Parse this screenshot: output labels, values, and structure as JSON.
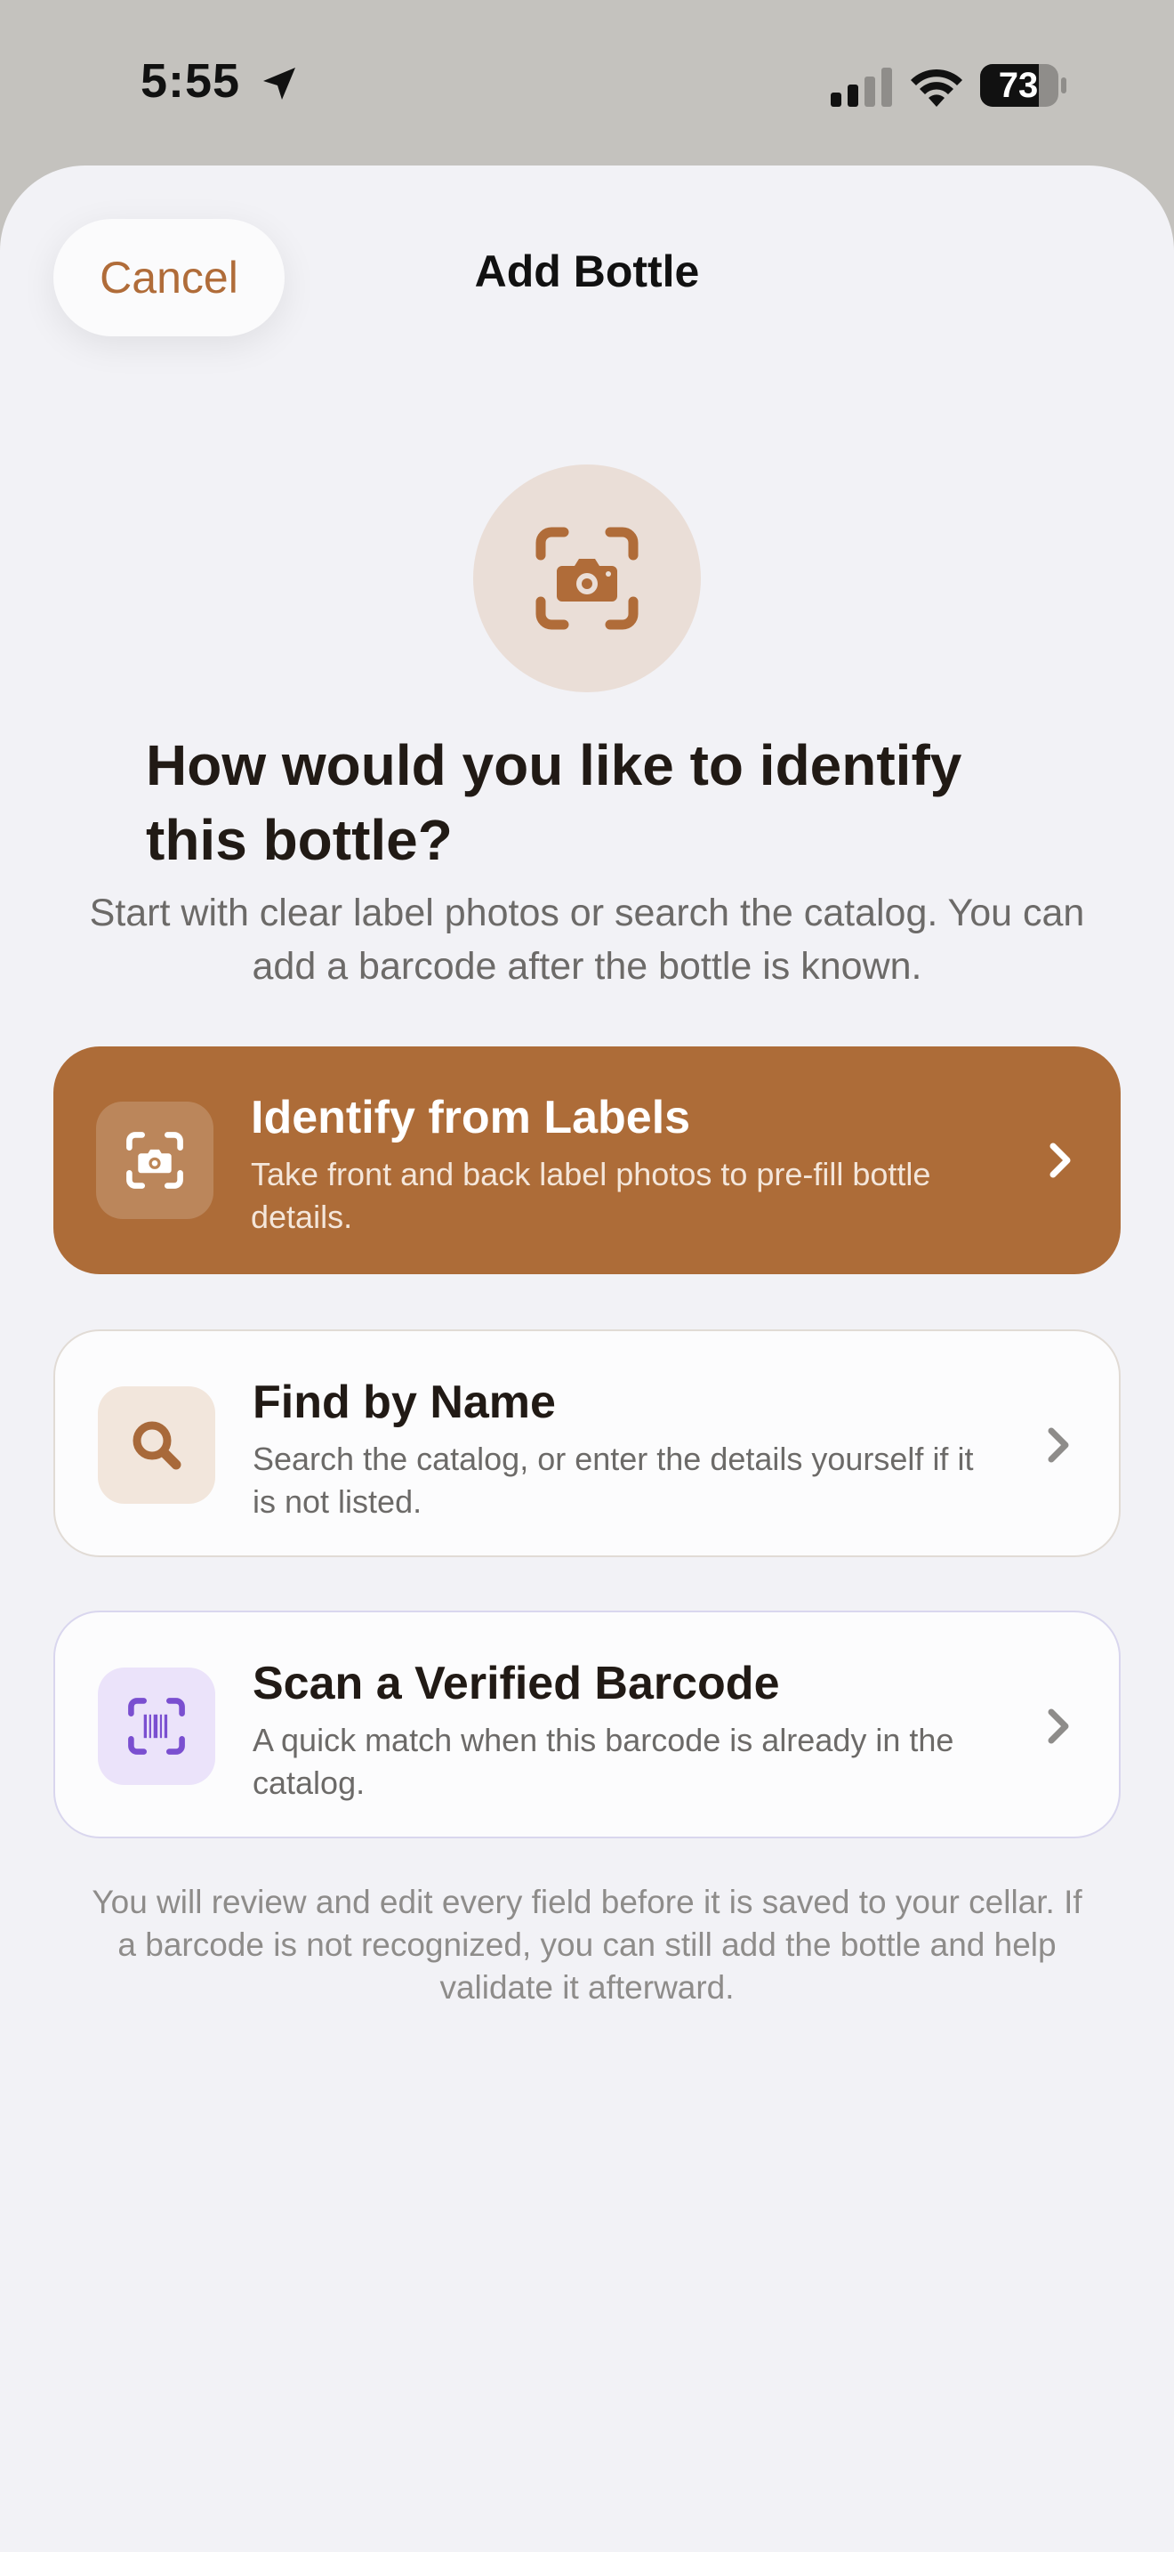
{
  "status_bar": {
    "time": "5:55",
    "battery": "73",
    "icons": [
      "location-arrow-icon",
      "cellular-signal-icon",
      "wifi-icon",
      "battery-icon"
    ]
  },
  "nav": {
    "cancel_label": "Cancel",
    "title": "Add Bottle"
  },
  "hero": {
    "icon": "camera-viewfinder-icon",
    "headline": "How would you like to identify this bottle?",
    "subhead": "Start with clear label photos or search the catalog. You can add a barcode after the bottle is known."
  },
  "options": [
    {
      "title": "Identify from Labels",
      "description": "Take front and back label photos to pre-fill bottle details.",
      "icon": "camera-viewfinder-icon",
      "style": "primary"
    },
    {
      "title": "Find by Name",
      "description": "Search the catalog, or enter the details yourself if it is not listed.",
      "icon": "search-icon",
      "style": "secondary"
    },
    {
      "title": "Scan a Verified Barcode",
      "description": "A quick match when this barcode is already in the catalog.",
      "icon": "barcode-viewfinder-icon",
      "style": "secondary"
    }
  ],
  "footnote": "You will review and edit every field before it is saved to your cellar. If a barcode is not recognized, you can still add the bottle and help validate it afterward.",
  "colors": {
    "accent": "#ad6c38",
    "sheet_background": "#f2f2f6",
    "barcode_accent": "#7a4fd0",
    "barcode_tile": "#ebe3fa",
    "search_tile": "#f2e6dc"
  }
}
